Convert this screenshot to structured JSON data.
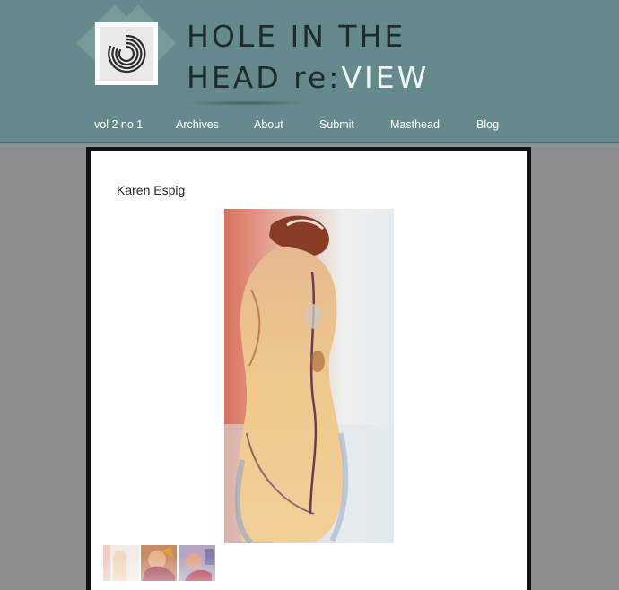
{
  "site": {
    "title_line1": "HOLE IN THE",
    "title_line2_a": "HEAD re:",
    "title_line2_b": "VIEW",
    "logo_icon": "concentric-arcs-logo-icon"
  },
  "nav": {
    "items": [
      {
        "label": "vol 2 no 1"
      },
      {
        "label": "Archives"
      },
      {
        "label": "About"
      },
      {
        "label": "Submit"
      },
      {
        "label": "Masthead"
      },
      {
        "label": "Blog"
      }
    ]
  },
  "main": {
    "artist_name": "Karen Espig",
    "gallery": {
      "selected_index": 0,
      "thumbnail_count": 3
    }
  },
  "colors": {
    "header_bg": "#668a8b",
    "page_bg": "#8e8e8e",
    "content_bg": "#ffffff",
    "border": "#111111",
    "nav_text": "#ffffff"
  }
}
